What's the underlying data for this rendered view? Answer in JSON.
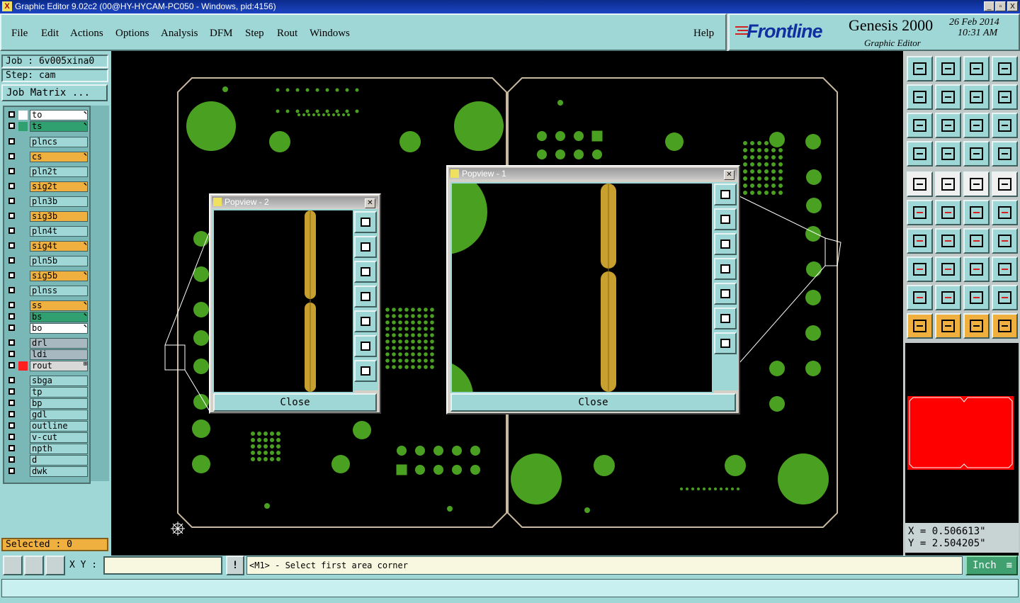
{
  "window": {
    "title": "Graphic Editor 9.02c2 (00@HY-HYCAM-PC050 - Windows, pid:4156)",
    "minimize": "_",
    "restore": "▫",
    "close": "X"
  },
  "menu": {
    "items": [
      "File",
      "Edit",
      "Actions",
      "Options",
      "Analysis",
      "DFM",
      "Step",
      "Rout",
      "Windows"
    ],
    "help": "Help"
  },
  "logo": {
    "brand": "Frontline",
    "product": "Genesis 2000",
    "subtitle": "Graphic Editor",
    "date": "26 Feb 2014",
    "time": "10:31 AM"
  },
  "job": {
    "job_label": "Job : 6v005xina0",
    "step_label": "Step: cam",
    "matrix_button": "Job Matrix ..."
  },
  "layers": [
    {
      "name": "to",
      "color": "#ffffff",
      "swatch": "#ffffff",
      "mark": "⬉"
    },
    {
      "name": "ts",
      "color": "#30a070",
      "swatch": "#30a070",
      "mark": "⬉"
    },
    {
      "name": "plncs",
      "color": "#9fd6d6",
      "swatch": "",
      "mark": ""
    },
    {
      "name": "cs",
      "color": "#f0b040",
      "swatch": "",
      "mark": "⬉"
    },
    {
      "name": "pln2t",
      "color": "#9fd6d6",
      "swatch": "",
      "mark": ""
    },
    {
      "name": "sig2t",
      "color": "#f0b040",
      "swatch": "",
      "mark": "⬉"
    },
    {
      "name": "pln3b",
      "color": "#9fd6d6",
      "swatch": "",
      "mark": ""
    },
    {
      "name": "sig3b",
      "color": "#f0b040",
      "swatch": "",
      "mark": ""
    },
    {
      "name": "pln4t",
      "color": "#9fd6d6",
      "swatch": "",
      "mark": ""
    },
    {
      "name": "sig4t",
      "color": "#f0b040",
      "swatch": "",
      "mark": "⬉"
    },
    {
      "name": "pln5b",
      "color": "#9fd6d6",
      "swatch": "",
      "mark": ""
    },
    {
      "name": "sig5b",
      "color": "#f0b040",
      "swatch": "",
      "mark": "⬉"
    },
    {
      "name": "plnss",
      "color": "#9fd6d6",
      "swatch": "",
      "mark": ""
    },
    {
      "name": "ss",
      "color": "#f0b040",
      "swatch": "",
      "mark": "⬉"
    },
    {
      "name": "bs",
      "color": "#30a070",
      "swatch": "",
      "mark": "⬉"
    },
    {
      "name": "bo",
      "color": "#ffffff",
      "swatch": "",
      "mark": "⬉"
    },
    {
      "name": "drl",
      "color": "#a8b8c0",
      "swatch": "",
      "mark": ""
    },
    {
      "name": "ldi",
      "color": "#a8b8c0",
      "swatch": "",
      "mark": ""
    },
    {
      "name": "rout",
      "color": "#d8d8d8",
      "swatch": "#ff2020",
      "mark": "⊞"
    },
    {
      "name": "sbga",
      "color": "#9fd6d6",
      "swatch": "",
      "mark": ""
    },
    {
      "name": "tp",
      "color": "#9fd6d6",
      "swatch": "",
      "mark": ""
    },
    {
      "name": "bp",
      "color": "#9fd6d6",
      "swatch": "",
      "mark": ""
    },
    {
      "name": "gdl",
      "color": "#9fd6d6",
      "swatch": "",
      "mark": ""
    },
    {
      "name": "outline",
      "color": "#9fd6d6",
      "swatch": "",
      "mark": ""
    },
    {
      "name": "v-cut",
      "color": "#9fd6d6",
      "swatch": "",
      "mark": ""
    },
    {
      "name": "npth",
      "color": "#9fd6d6",
      "swatch": "",
      "mark": ""
    },
    {
      "name": "d",
      "color": "#9fd6d6",
      "swatch": "",
      "mark": ""
    },
    {
      "name": "dwk",
      "color": "#9fd6d6",
      "swatch": "",
      "mark": ""
    }
  ],
  "selected": "Selected : 0",
  "popview2": {
    "title": "Popview - 2",
    "close_label": "Close"
  },
  "popview1": {
    "title": "Popview - 1",
    "close_label": "Close"
  },
  "readout": {
    "x": "X = 0.506613\"",
    "y": "Y = 2.504205\""
  },
  "statusbar": {
    "xy_label": "X Y :",
    "xy_value": "",
    "alert_icon": "!",
    "message": "<M1> - Select first area corner",
    "units": "Inch"
  },
  "colors": {
    "panel": "#9fd6d6",
    "pad_green": "#4aa020",
    "trace_gold": "#c8a030",
    "profile": "#c8b8a0",
    "overview_red": "#ff0000"
  }
}
